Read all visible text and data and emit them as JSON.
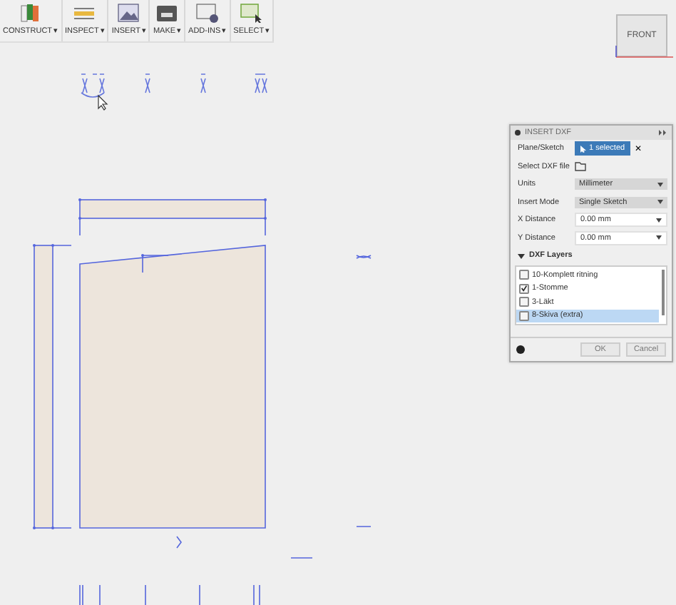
{
  "toolbar": [
    {
      "label": "CONSTRUCT",
      "caret": "▾",
      "kind": "construct"
    },
    {
      "label": "INSPECT",
      "caret": "▾",
      "kind": "inspect"
    },
    {
      "label": "INSERT",
      "caret": "▾",
      "kind": "insert"
    },
    {
      "label": "MAKE",
      "caret": "▾",
      "kind": "make"
    },
    {
      "label": "ADD-INS",
      "caret": "▾",
      "kind": "addins"
    },
    {
      "label": "SELECT",
      "caret": "▾",
      "kind": "select"
    }
  ],
  "viewcube": {
    "face": "FRONT"
  },
  "panel": {
    "title": "INSERT DXF",
    "rows": [
      {
        "kind": "selection",
        "label": "Plane/Sketch",
        "value": "1 selected",
        "clear": "✕"
      },
      {
        "kind": "file",
        "label": "Select DXF file"
      },
      {
        "kind": "dropdown",
        "label": "Units",
        "value": "Millimeter"
      },
      {
        "kind": "dropdown",
        "label": "Insert Mode",
        "value": "Single Sketch"
      },
      {
        "kind": "input",
        "label": "X Distance",
        "value": "0.00 mm"
      },
      {
        "kind": "input",
        "label": "Y Distance",
        "value": "0.00 mm"
      }
    ],
    "section": {
      "title": "DXF Layers",
      "expanded": true
    },
    "layers": [
      {
        "name": "10-Komplett ritning",
        "checked": false,
        "selected": false
      },
      {
        "name": "1-Stomme",
        "checked": true,
        "selected": false
      },
      {
        "name": "3-Läkt",
        "checked": false,
        "selected": false
      },
      {
        "name": "8-Skiva (extra)",
        "checked": false,
        "selected": true
      }
    ],
    "buttons": [
      "OK",
      "Cancel"
    ]
  }
}
